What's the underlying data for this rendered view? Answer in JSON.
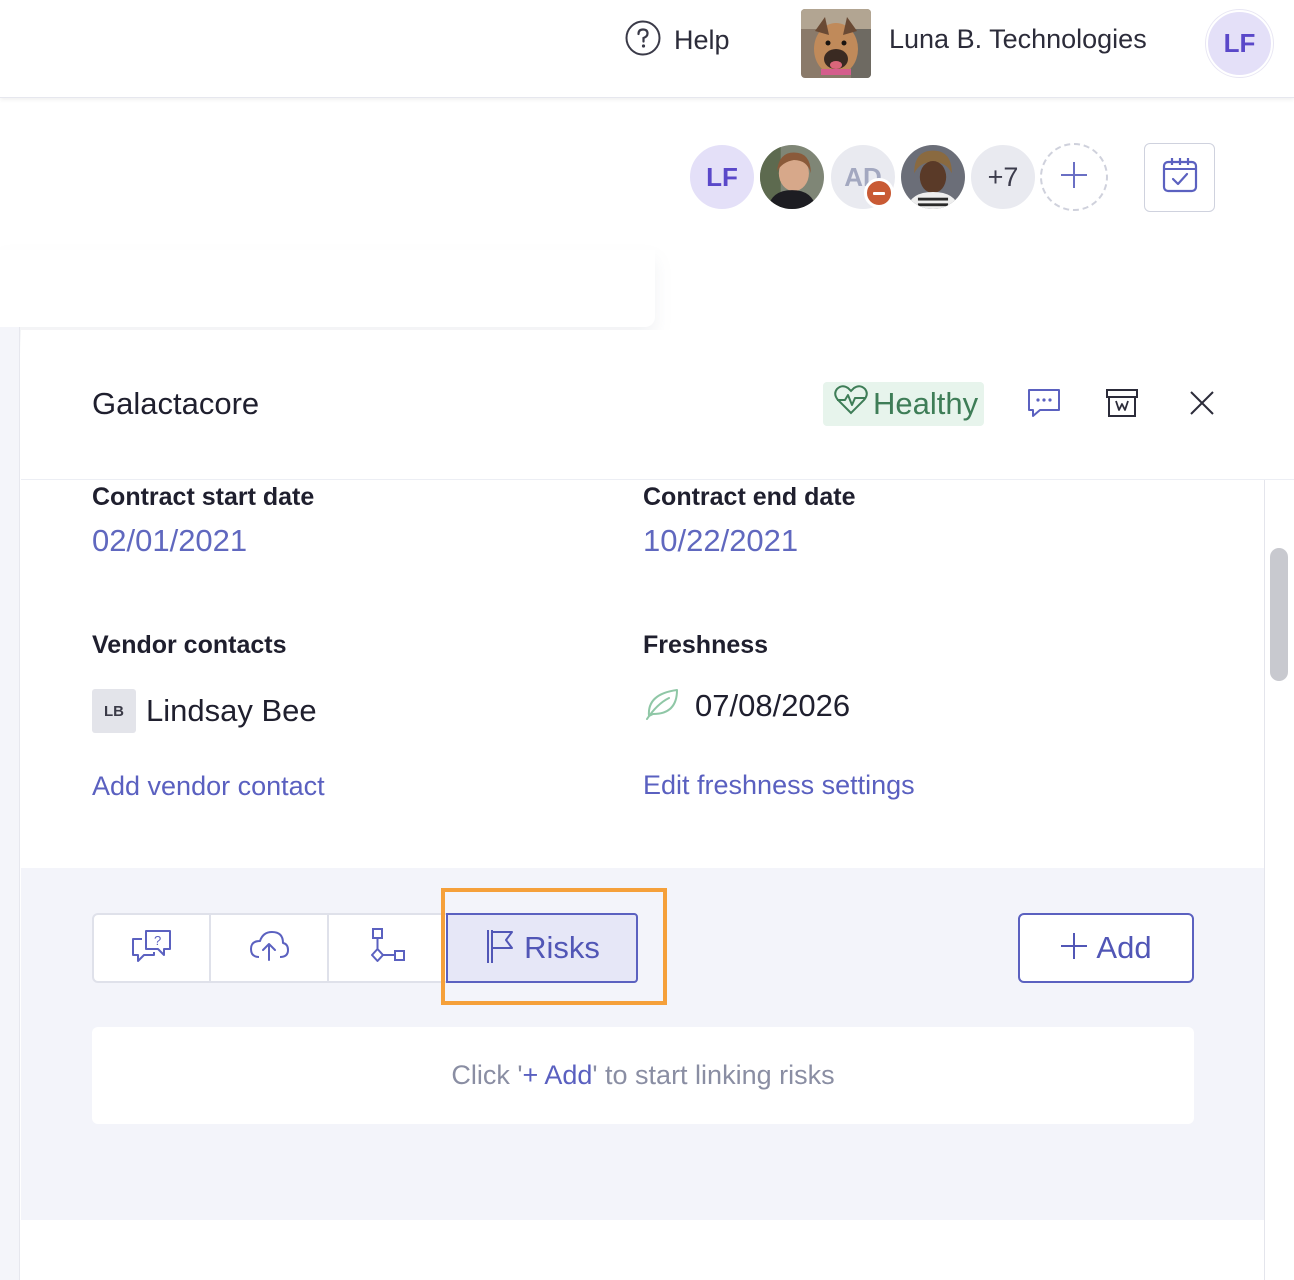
{
  "header": {
    "help_label": "Help",
    "org_name": "Luna B. Technologies",
    "user_initials": "LF"
  },
  "members": {
    "first_initials": "LF",
    "removed_initials": "AD",
    "more_count": "+7"
  },
  "drawer": {
    "vendor_name": "Galactacore",
    "health_status": "Healthy",
    "contract_start_label": "Contract start date",
    "contract_start_value": "02/01/2021",
    "contract_end_label": "Contract end date",
    "contract_end_value": "10/22/2021",
    "vendor_contacts_label": "Vendor contacts",
    "contact_initials": "LB",
    "contact_name": "Lindsay Bee",
    "add_contact_link": "Add vendor contact",
    "freshness_label": "Freshness",
    "freshness_date": "07/08/2026",
    "edit_freshness_link": "Edit freshness settings"
  },
  "tabs": {
    "risks_label": "Risks",
    "add_label": "Add"
  },
  "empty_state": {
    "prefix": "Click '",
    "link": "+ Add",
    "suffix": "' to start linking risks"
  },
  "colors": {
    "accent": "#5b61c0",
    "health_green": "#3e7d57",
    "highlight_orange": "#f5a03a",
    "avatar_purple": "#5a48c9"
  }
}
